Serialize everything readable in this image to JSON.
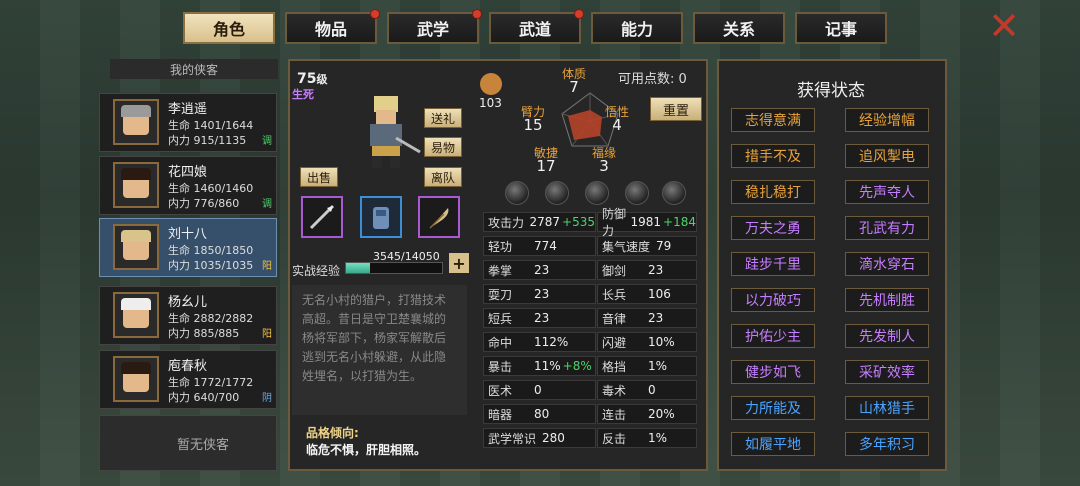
{
  "tabs": [
    {
      "label": "角色",
      "active": true,
      "badge": false
    },
    {
      "label": "物品",
      "active": false,
      "badge": true
    },
    {
      "label": "武学",
      "active": false,
      "badge": true
    },
    {
      "label": "武道",
      "active": false,
      "badge": true
    },
    {
      "label": "能力",
      "active": false,
      "badge": false
    },
    {
      "label": "关系",
      "active": false,
      "badge": false
    },
    {
      "label": "记事",
      "active": false,
      "badge": false
    }
  ],
  "close_label": "✕",
  "roster": {
    "header": "我的侠客",
    "heroes": [
      {
        "name": "李逍遥",
        "hp": "生命 1401/1644",
        "mp": "内力 915/1135",
        "tag": "调",
        "tag_color": "#4fd36b"
      },
      {
        "name": "花四娘",
        "hp": "生命 1460/1460",
        "mp": "内力 776/860",
        "tag": "调",
        "tag_color": "#4fd36b"
      },
      {
        "name": "刘十八",
        "hp": "生命 1850/1850",
        "mp": "内力 1035/1035",
        "tag": "阳",
        "tag_color": "#f0c040"
      },
      {
        "name": "杨幺儿",
        "hp": "生命 2882/2882",
        "mp": "内力 885/885",
        "tag": "阳",
        "tag_color": "#f0c040"
      },
      {
        "name": "庖春秋",
        "hp": "生命 1772/1772",
        "mp": "内力 640/700",
        "tag": "阴",
        "tag_color": "#6aa8e8"
      }
    ],
    "empty_label": "暂无侠客"
  },
  "character": {
    "level": "75",
    "level_unit": "级",
    "life_state": "生死",
    "buttons": {
      "gift": "送礼",
      "trade": "易物",
      "leave": "离队",
      "sell": "出售"
    },
    "exp_label": "实战经验",
    "exp_text": "3545/14050",
    "exp_fraction": 0.2523,
    "exp_plus": "+",
    "bio": "无名小村的猎户，打猎技术高超。昔日是守卫楚襄城的杨将军部下，杨家军解散后逃到无名小村躲避，从此隐姓埋名，以打猎为生。",
    "trait_title": "品格倾向:",
    "trait_text": "临危不惧，肝胆相照。"
  },
  "attributes": {
    "gold_value": "103",
    "points_label": "可用点数: 0",
    "reset_label": "重置",
    "items": [
      {
        "label": "体质",
        "value": "7"
      },
      {
        "label": "悟性",
        "value": "4"
      },
      {
        "label": "福缘",
        "value": "3"
      },
      {
        "label": "敏捷",
        "value": "17"
      },
      {
        "label": "臂力",
        "value": "15"
      }
    ]
  },
  "stats": [
    {
      "label": "攻击力",
      "value": "2787",
      "bonus": "+535"
    },
    {
      "label": "防御力",
      "value": "1981",
      "bonus": "+184"
    },
    {
      "label": "轻功",
      "value": "774",
      "bonus": ""
    },
    {
      "label": "集气速度",
      "value": "79",
      "bonus": ""
    },
    {
      "label": "拳掌",
      "value": "23",
      "bonus": ""
    },
    {
      "label": "御剑",
      "value": "23",
      "bonus": ""
    },
    {
      "label": "耍刀",
      "value": "23",
      "bonus": ""
    },
    {
      "label": "长兵",
      "value": "106",
      "bonus": ""
    },
    {
      "label": "短兵",
      "value": "23",
      "bonus": ""
    },
    {
      "label": "音律",
      "value": "23",
      "bonus": ""
    },
    {
      "label": "命中",
      "value": "112%",
      "bonus": ""
    },
    {
      "label": "闪避",
      "value": "10%",
      "bonus": ""
    },
    {
      "label": "暴击",
      "value": "11%",
      "bonus": "+8%"
    },
    {
      "label": "格挡",
      "value": "1%",
      "bonus": ""
    },
    {
      "label": "医术",
      "value": "0",
      "bonus": ""
    },
    {
      "label": "毒术",
      "value": "0",
      "bonus": ""
    },
    {
      "label": "暗器",
      "value": "80",
      "bonus": ""
    },
    {
      "label": "连击",
      "value": "20%",
      "bonus": ""
    },
    {
      "label": "武学常识",
      "value": "280",
      "bonus": ""
    },
    {
      "label": "反击",
      "value": "1%",
      "bonus": ""
    }
  ],
  "status": {
    "title": "获得状态",
    "items": [
      {
        "label": "志得意满",
        "color": "#e8a23a"
      },
      {
        "label": "经验增幅",
        "color": "#e8a23a"
      },
      {
        "label": "措手不及",
        "color": "#e8a23a"
      },
      {
        "label": "追风掣电",
        "color": "#e8a23a"
      },
      {
        "label": "稳扎稳打",
        "color": "#e8a23a"
      },
      {
        "label": "先声夺人",
        "color": "#c77dff"
      },
      {
        "label": "万夫之勇",
        "color": "#c77dff"
      },
      {
        "label": "孔武有力",
        "color": "#c77dff"
      },
      {
        "label": "跬步千里",
        "color": "#c77dff"
      },
      {
        "label": "滴水穿石",
        "color": "#c77dff"
      },
      {
        "label": "以力破巧",
        "color": "#c77dff"
      },
      {
        "label": "先机制胜",
        "color": "#c77dff"
      },
      {
        "label": "护佑少主",
        "color": "#c77dff"
      },
      {
        "label": "先发制人",
        "color": "#c77dff"
      },
      {
        "label": "健步如飞",
        "color": "#c77dff"
      },
      {
        "label": "采矿效率",
        "color": "#c77dff"
      },
      {
        "label": "力所能及",
        "color": "#4aa3ff"
      },
      {
        "label": "山林猎手",
        "color": "#4aa3ff"
      },
      {
        "label": "如履平地",
        "color": "#4aa3ff"
      },
      {
        "label": "多年积习",
        "color": "#4aa3ff"
      }
    ]
  }
}
